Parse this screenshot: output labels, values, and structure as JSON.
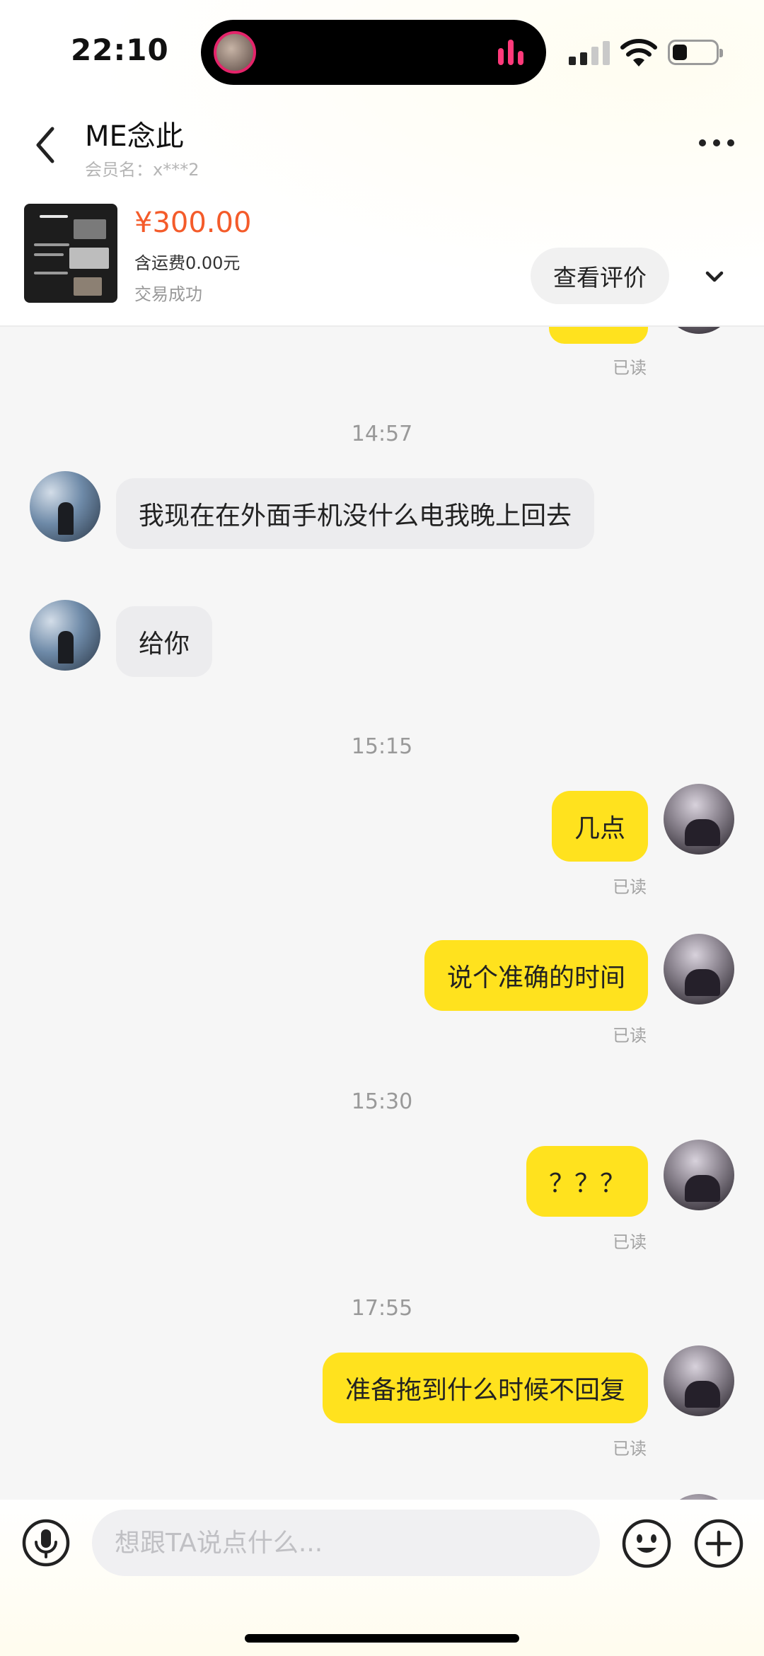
{
  "status_bar": {
    "time": "22:10"
  },
  "header": {
    "title": "ME念此",
    "subtitle": "会员名：x***2"
  },
  "product": {
    "price": "¥300.00",
    "shipping": "含运费0.00元",
    "status": "交易成功",
    "review_button": "查看评价"
  },
  "chat": {
    "read_label": "已读",
    "times": [
      "14:57",
      "15:15",
      "15:30",
      "17:55"
    ],
    "messages": [
      {
        "from": "peer",
        "text": "我现在在外面手机没什么电我晚上回去"
      },
      {
        "from": "peer",
        "text": "给你"
      },
      {
        "from": "me",
        "text": "几点"
      },
      {
        "from": "me",
        "text": "说个准确的时间"
      },
      {
        "from": "me",
        "text": "？？？"
      },
      {
        "from": "me",
        "text": "准备拖到什么时候不回复"
      }
    ]
  },
  "input": {
    "placeholder": "想跟TA说点什么..."
  },
  "colors": {
    "accent_yellow": "#ffe21e",
    "price_orange": "#f45b2a"
  },
  "icons": [
    "back-icon",
    "more-icon",
    "chevron-down-icon",
    "microphone-icon",
    "emoji-icon",
    "plus-icon",
    "wifi-icon",
    "battery-icon",
    "signal-icon"
  ]
}
